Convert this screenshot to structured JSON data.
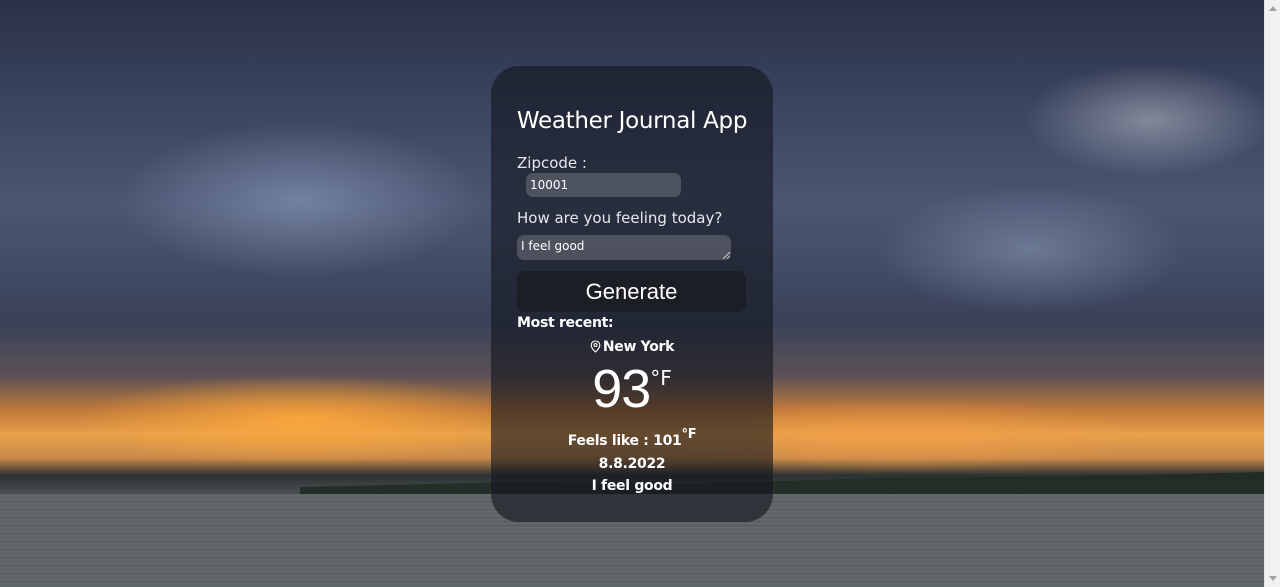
{
  "app": {
    "title": "Weather Journal App"
  },
  "form": {
    "zip_label": "Zipcode :",
    "zip_value": "10001",
    "feeling_label": "How are you feeling today?",
    "feeling_value": "I feel good",
    "generate_label": "Generate"
  },
  "recent": {
    "heading": "Most recent:",
    "location_icon": "map-pin-icon",
    "city": "New York",
    "temperature": "93",
    "temp_unit": "°F",
    "feels_like_text": "Feels like : 101",
    "feels_like_unit": "°F",
    "date": "8.8.2022",
    "content": "I feel good"
  }
}
